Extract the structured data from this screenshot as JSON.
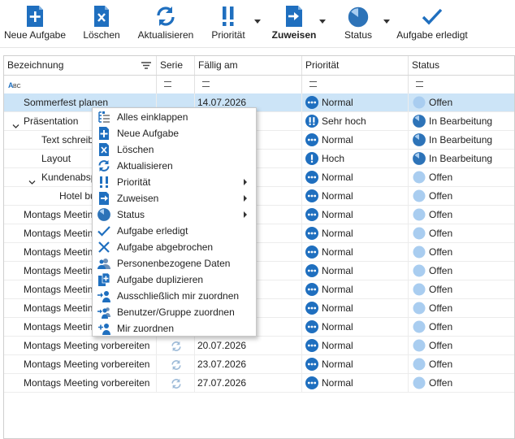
{
  "toolbar": {
    "new_task": "Neue Aufgabe",
    "delete": "Löschen",
    "refresh": "Aktualisieren",
    "priority": "Priorität",
    "assign": "Zuweisen",
    "status": "Status",
    "done": "Aufgabe erledigt"
  },
  "columns": {
    "name": "Bezeichnung",
    "serie": "Serie",
    "due": "Fällig am",
    "priority": "Priorität",
    "status": "Status"
  },
  "colors": {
    "accent": "#1f6fbf",
    "selection": "#cce4f7",
    "status_open": "#a9cdf0"
  },
  "rows": [
    {
      "name": "Sommerfest planen",
      "due": "14.07.2026",
      "priority": "Normal",
      "status": "Offen"
    },
    {
      "name": "Präsentation",
      "due": "",
      "priority": "Sehr hoch",
      "status": "In Bearbeitung"
    },
    {
      "name": "Text schreiben",
      "due": "",
      "priority": "Normal",
      "status": "In Bearbeitung"
    },
    {
      "name": "Layout",
      "due": "",
      "priority": "Hoch",
      "status": "In Bearbeitung"
    },
    {
      "name": "Kundenabsprache",
      "due": "",
      "priority": "Normal",
      "status": "Offen"
    },
    {
      "name": "Hotel buchen",
      "due": "",
      "priority": "Normal",
      "status": "Offen"
    },
    {
      "name": "Montags Meeting vorbereiten",
      "due": "",
      "priority": "Normal",
      "status": "Offen"
    },
    {
      "name": "Montags Meeting vorbereiten",
      "due": "",
      "priority": "Normal",
      "status": "Offen"
    },
    {
      "name": "Montags Meeting vorbereiten",
      "due": "",
      "priority": "Normal",
      "status": "Offen"
    },
    {
      "name": "Montags Meeting vorbereiten",
      "due": "",
      "priority": "Normal",
      "status": "Offen"
    },
    {
      "name": "Montags Meeting vorbereiten",
      "due": "",
      "priority": "Normal",
      "status": "Offen"
    },
    {
      "name": "Montags Meeting vorbereiten",
      "due": "",
      "priority": "Normal",
      "status": "Offen"
    },
    {
      "name": "Montags Meeting vorbereiten",
      "due": "",
      "priority": "Normal",
      "status": "Offen"
    },
    {
      "name": "Montags Meeting vorbereiten",
      "due": "20.07.2026",
      "priority": "Normal",
      "status": "Offen"
    },
    {
      "name": "Montags Meeting vorbereiten",
      "due": "23.07.2026",
      "priority": "Normal",
      "status": "Offen"
    },
    {
      "name": "Montags Meeting vorbereiten",
      "due": "27.07.2026",
      "priority": "Normal",
      "status": "Offen"
    }
  ],
  "menu": {
    "items": [
      {
        "label": "Alles einklappen",
        "icon": "collapse-all-icon"
      },
      {
        "label": "Neue Aufgabe",
        "icon": "new-task-icon"
      },
      {
        "label": "Löschen",
        "icon": "delete-icon"
      },
      {
        "label": "Aktualisieren",
        "icon": "refresh-icon"
      },
      {
        "label": "Priorität",
        "icon": "priority-icon",
        "submenu": true
      },
      {
        "label": "Zuweisen",
        "icon": "assign-icon",
        "submenu": true
      },
      {
        "label": "Status",
        "icon": "status-icon",
        "submenu": true
      },
      {
        "label": "Aufgabe erledigt",
        "icon": "checkmark-icon"
      },
      {
        "label": "Aufgabe abgebrochen",
        "icon": "cancel-x-icon"
      },
      {
        "label": "Personenbezogene Daten",
        "icon": "personal-data-icon"
      },
      {
        "label": "Aufgabe duplizieren",
        "icon": "duplicate-icon"
      },
      {
        "label": "Ausschließlich mir zuordnen",
        "icon": "assign-only-me-icon"
      },
      {
        "label": "Benutzer/Gruppe zuordnen",
        "icon": "assign-group-icon"
      },
      {
        "label": "Mir zuordnen",
        "icon": "assign-me-icon"
      }
    ]
  }
}
